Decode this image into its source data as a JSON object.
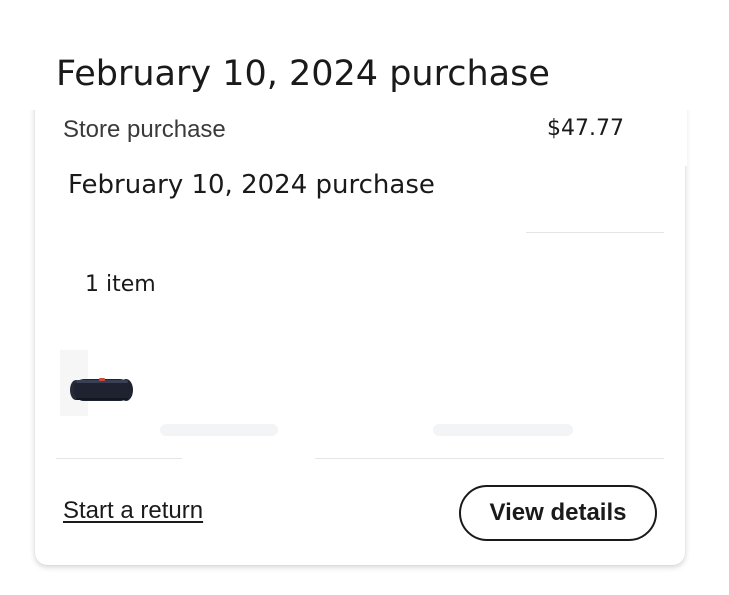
{
  "page": {
    "title": "February 10, 2024 purchase"
  },
  "order": {
    "store_label": "Store purchase",
    "total": "$47.77",
    "subtitle": "February 10, 2024 purchase",
    "item_count": "1 item",
    "product_icon": "bluetooth-speaker-image"
  },
  "actions": {
    "start_return": "Start a return",
    "view_details": "View details"
  },
  "colors": {
    "text": "#1a1a1a",
    "muted_text": "#3a3a3a",
    "divider": "#e3e4e5",
    "background": "#ffffff"
  }
}
